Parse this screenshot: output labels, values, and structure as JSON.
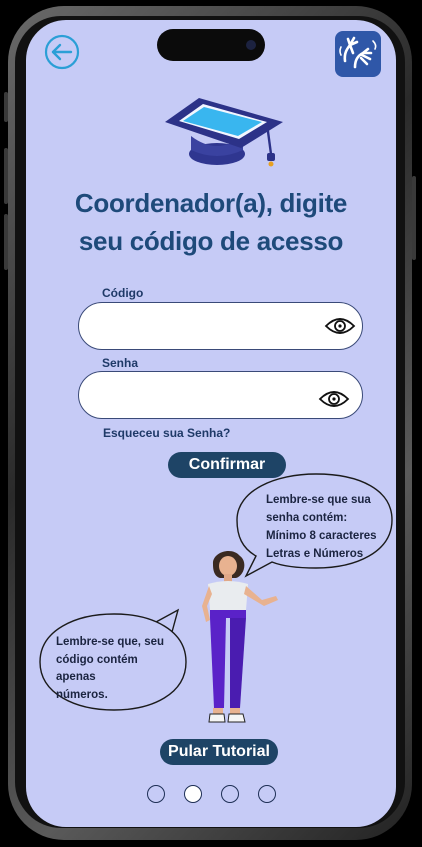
{
  "title": {
    "line1": "Coordenador(a), digite",
    "line2": "seu código de acesso"
  },
  "form": {
    "code_label": "Código",
    "code_value": "",
    "password_label": "Senha",
    "password_value": "",
    "forgot_link": "Esqueceu sua Senha?",
    "confirm_label": "Confirmar"
  },
  "tips": {
    "password_tip": [
      "Lembre-se que sua",
      "senha contém:",
      "Mínimo 8 caracteres",
      "Letras e Números"
    ],
    "code_tip": [
      "Lembre-se que, seu",
      "código  contém apenas",
      "números."
    ]
  },
  "skip_label": "Pular Tutorial",
  "pagination": {
    "total": 4,
    "active_index": 1
  },
  "colors": {
    "background": "#c6cbf6",
    "title": "#1e4a7a",
    "button": "#1e4466",
    "libras_button": "#2f57a8",
    "back_icon": "#2b9fd6"
  },
  "icons": {
    "back": "arrow-left-circle-icon",
    "accessibility": "sign-language-icon",
    "graduation": "graduation-cap-tablet-icon",
    "password_visibility": "eye-icon"
  }
}
